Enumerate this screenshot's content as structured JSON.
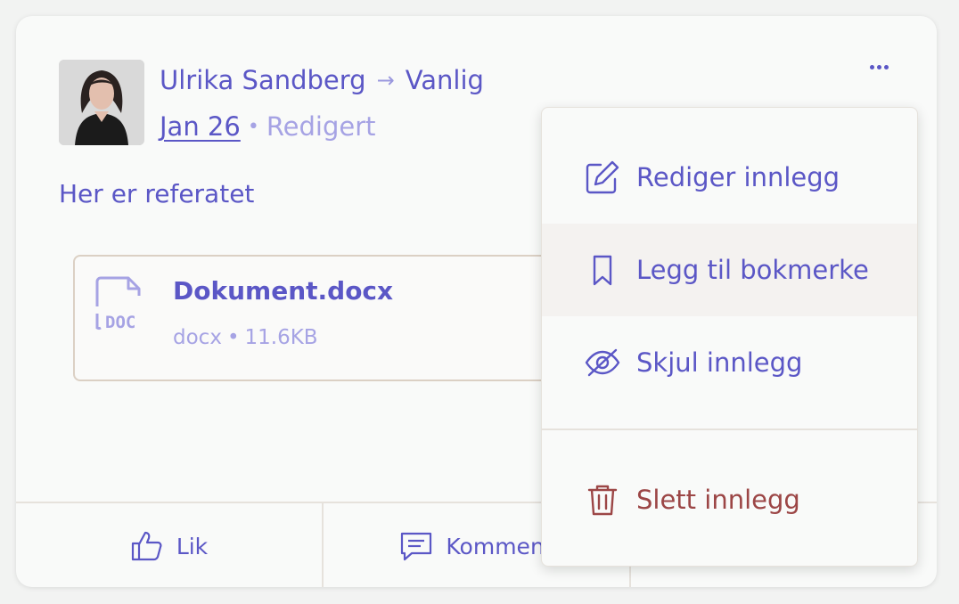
{
  "post": {
    "author": "Ulrika Sandberg",
    "arrow": "→",
    "target": "Vanlig",
    "date": "Jan 26",
    "separator": "•",
    "edited": "Redigert",
    "text": "Her er referatet"
  },
  "attachment": {
    "icon": "doc-file-icon",
    "icon_text": "DOC",
    "name": "Dokument.docx",
    "type": "docx",
    "separator": "•",
    "size": "11.6KB"
  },
  "footer": {
    "like_label": "Lik",
    "comment_label": "Komment"
  },
  "menu": {
    "items": [
      {
        "label": "Rediger innlegg",
        "icon": "edit-icon"
      },
      {
        "label": "Legg til bokmerke",
        "icon": "bookmark-icon"
      },
      {
        "label": "Skjul innlegg",
        "icon": "eye-off-icon"
      },
      {
        "label": "Slett innlegg",
        "icon": "trash-icon"
      }
    ]
  },
  "colors": {
    "accent": "#5b57c6",
    "muted": "#a6a3e4",
    "danger": "#9c4646",
    "border": "#e6e2dc"
  }
}
